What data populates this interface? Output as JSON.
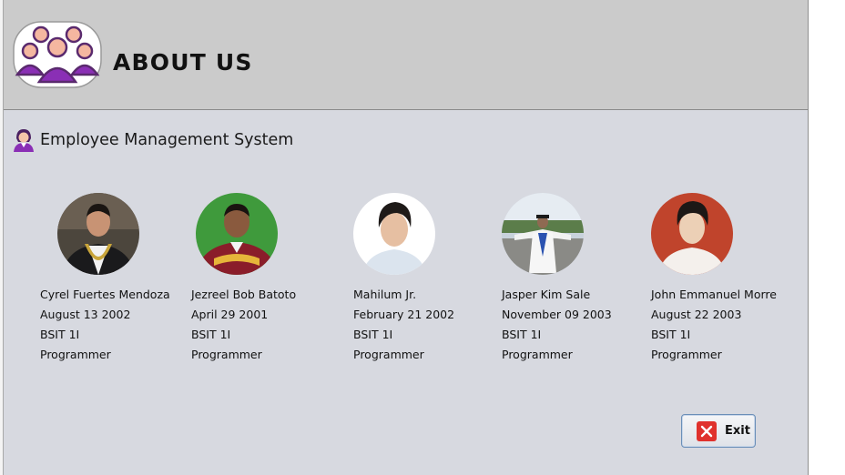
{
  "window": {
    "title": "ABOUT US",
    "subtitle": "Employee Management System"
  },
  "icons": {
    "logo": "team-group-icon",
    "subtitle": "employee-icon",
    "exit": "close-x-icon"
  },
  "members": [
    {
      "name": "Cyrel Fuertes Mendoza",
      "birthday": "August 13 2002",
      "section": "BSIT 1I",
      "role": "Programmer"
    },
    {
      "name": "Jezreel Bob Batoto",
      "birthday": "April 29 2001",
      "section": "BSIT 1I",
      "role": "Programmer"
    },
    {
      "name": "Mahilum Jr.",
      "birthday": "February 21 2002",
      "section": "BSIT 1I",
      "role": "Programmer"
    },
    {
      "name": "Jasper Kim Sale",
      "birthday": "November 09 2003",
      "section": "BSIT 1I",
      "role": "Programmer"
    },
    {
      "name": "John Emmanuel Morre",
      "birthday": "August 22 2003",
      "section": "BSIT 1I",
      "role": "Programmer"
    }
  ],
  "buttons": {
    "exit": "Exit"
  },
  "colors": {
    "header": "#cbcbcb",
    "body": "#d7d9e0",
    "accent": "#7b2fa8",
    "exit_icon": "#e0322d"
  }
}
